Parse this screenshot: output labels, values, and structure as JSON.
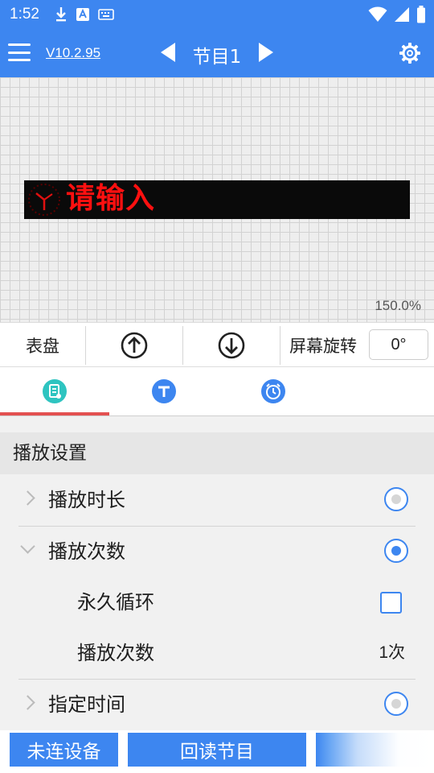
{
  "status_bar": {
    "time": "1:52",
    "icons": [
      "download-icon",
      "keyboard-app-icon",
      "keyboard-icon",
      "wifi-icon",
      "signal-icon",
      "battery-icon"
    ]
  },
  "toolbar": {
    "version": "V10.2.95",
    "program_title": "节目1"
  },
  "preview": {
    "led_text": "请输入",
    "led_text_color": "#ff1010",
    "zoom": "150.0%"
  },
  "controls": {
    "dial_label": "表盘",
    "rotation_label": "屏幕旋转",
    "rotation_value": "0°"
  },
  "tabs": [
    {
      "icon": "program-list-icon",
      "color": "#2ec4c0",
      "selected": true
    },
    {
      "icon": "text-icon",
      "color": "#3d86f0",
      "selected": false
    },
    {
      "icon": "alarm-clock-icon",
      "color": "#3d86f0",
      "selected": false
    }
  ],
  "playback": {
    "section_title": "播放设置",
    "duration_label": "播放时长",
    "times_label": "播放次数",
    "loop_label": "永久循环",
    "count_label": "播放次数",
    "count_value": "1次",
    "scheduled_label": "指定时间"
  },
  "bottom": {
    "connect_label": "未连设备",
    "readback_label": "回读节目"
  },
  "colors": {
    "accent": "#3d86f0",
    "tab_indicator": "#e35050"
  }
}
